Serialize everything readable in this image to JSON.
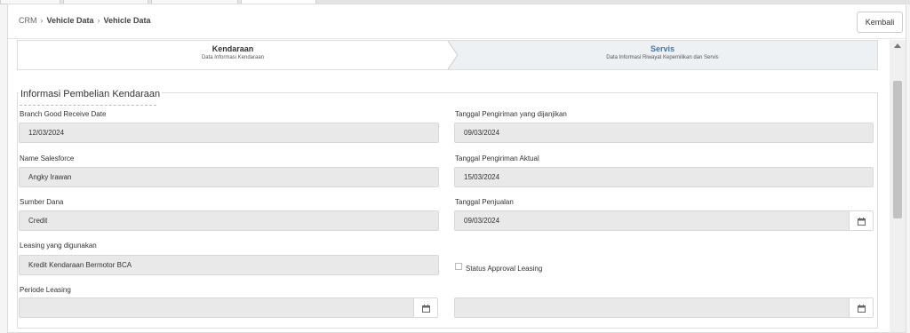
{
  "breadcrumb": {
    "root": "CRM",
    "level1": "Vehicle Data",
    "level2": "Vehicle Data"
  },
  "header": {
    "back_label": "Kembali"
  },
  "steps": [
    {
      "title": "Kendaraan",
      "subtitle": "Data Informasi Kendaraan"
    },
    {
      "title": "Servis",
      "subtitle": "Data Informasi Riwayat Kepemilikan dan Servis"
    }
  ],
  "section": {
    "title": "Informasi Pembelian Kendaraan",
    "fields": {
      "branch_good_receive_date": {
        "label": "Branch Good Receive Date",
        "value": "12/03/2024"
      },
      "tanggal_pengiriman_dijanjikan": {
        "label": "Tanggal Pengiriman yang dijanjikan",
        "value": "09/03/2024"
      },
      "name_salesforce": {
        "label": "Name Salesforce",
        "value": "Angky Irawan"
      },
      "tanggal_pengiriman_aktual": {
        "label": "Tanggal Pengiriman Aktual",
        "value": "15/03/2024"
      },
      "sumber_dana": {
        "label": "Sumber Dana",
        "value": "Credit"
      },
      "tanggal_penjualan": {
        "label": "Tanggal Penjualan",
        "value": "09/03/2024"
      },
      "leasing": {
        "label": "Leasing yang digunakan",
        "value": "Kredit Kendaraan Bermotor BCA"
      },
      "status_approval_leasing": {
        "label": "Status Approval Leasing",
        "checked": false
      },
      "periode_leasing": {
        "label": "Periode Leasing",
        "value": ""
      },
      "periode_leasing_end": {
        "value": ""
      }
    }
  },
  "icons": {
    "calendar": "calendar-icon",
    "scroll_up": "scroll-up-arrow-icon"
  }
}
